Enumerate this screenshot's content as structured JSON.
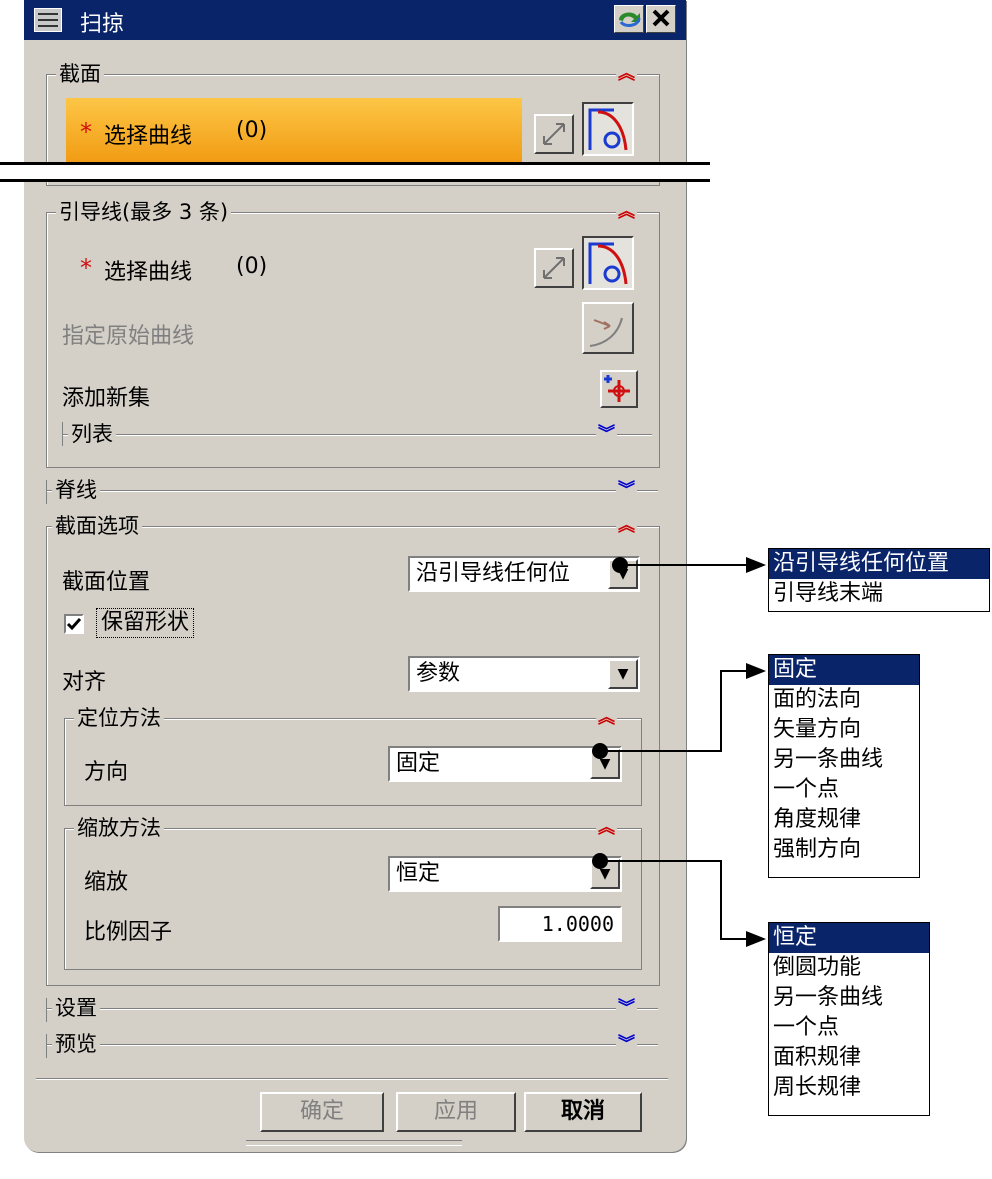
{
  "window": {
    "title": "扫掠"
  },
  "section": {
    "label": "截面",
    "select_star": "*",
    "select_label": "选择曲线",
    "select_count": "(0)"
  },
  "guides": {
    "label": "引导线(最多 3 条)",
    "select_star": "*",
    "select_label": "选择曲线",
    "select_count": "(0)",
    "origin_curve": "指定原始曲线",
    "add_set": "添加新集",
    "list_label": "列表"
  },
  "spine": {
    "label": "脊线"
  },
  "section_options": {
    "label": "截面选项",
    "position_label": "截面位置",
    "position_value": "沿引导线任何位",
    "keep_shape_label": "保留形状",
    "keep_shape_checked": true,
    "align_label": "对齐",
    "align_value": "参数",
    "orientation": {
      "label": "定位方法",
      "direction_label": "方向",
      "direction_value": "固定"
    },
    "scaling": {
      "label": "缩放方法",
      "scale_label": "缩放",
      "scale_value": "恒定",
      "factor_label": "比例因子",
      "factor_value": "1.0000"
    }
  },
  "settings": {
    "label": "设置"
  },
  "preview": {
    "label": "预览"
  },
  "buttons": {
    "ok": "确定",
    "apply": "应用",
    "cancel": "取消"
  },
  "callouts": {
    "position_options": [
      "沿引导线任何位置",
      "引导线末端"
    ],
    "direction_options": [
      "固定",
      "面的法向",
      "矢量方向",
      "另一条曲线",
      "一个点",
      "角度规律",
      "强制方向"
    ],
    "scale_options": [
      "恒定",
      "倒圆功能",
      "另一条曲线",
      "一个点",
      "面积规律",
      "周长规律"
    ]
  },
  "colors": {
    "titlebar": "#0a246a",
    "dialog": "#d4d0c8",
    "highlight": "#f7a21a",
    "selected": "#0a246a"
  }
}
